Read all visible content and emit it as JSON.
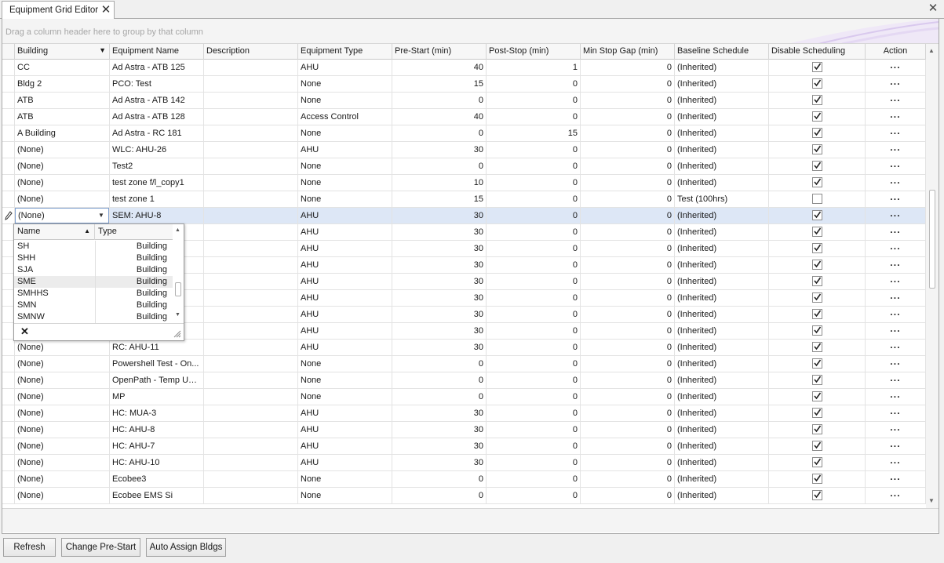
{
  "tab": {
    "title": "Equipment Grid Editor",
    "close_glyph": "✕"
  },
  "window": {
    "close_glyph": "✕"
  },
  "group_panel": {
    "hint": "Drag a column header here to group by that column"
  },
  "columns": [
    {
      "key": "building",
      "label": "Building",
      "sorted": "descending"
    },
    {
      "key": "equipment_name",
      "label": "Equipment Name"
    },
    {
      "key": "description",
      "label": "Description"
    },
    {
      "key": "equipment_type",
      "label": "Equipment Type"
    },
    {
      "key": "pre_start",
      "label": "Pre-Start (min)"
    },
    {
      "key": "post_stop",
      "label": "Post-Stop (min)"
    },
    {
      "key": "min_stop_gap",
      "label": "Min Stop Gap (min)"
    },
    {
      "key": "baseline_schedule",
      "label": "Baseline Schedule"
    },
    {
      "key": "disable_scheduling",
      "label": "Disable Scheduling"
    },
    {
      "key": "action",
      "label": "Action"
    }
  ],
  "rows": [
    {
      "building": "CC",
      "equipment_name": "Ad Astra - ATB 125",
      "description": "",
      "equipment_type": "AHU",
      "pre_start": "40",
      "post_stop": "1",
      "min_stop_gap": "0",
      "baseline_schedule": "(Inherited)",
      "disable_scheduling": true,
      "action": "···"
    },
    {
      "building": "Bldg 2",
      "equipment_name": "PCO: Test",
      "description": "",
      "equipment_type": "None",
      "pre_start": "15",
      "post_stop": "0",
      "min_stop_gap": "0",
      "baseline_schedule": "(Inherited)",
      "disable_scheduling": true,
      "action": "···"
    },
    {
      "building": "ATB",
      "equipment_name": "Ad Astra - ATB 142",
      "description": "",
      "equipment_type": "None",
      "pre_start": "0",
      "post_stop": "0",
      "min_stop_gap": "0",
      "baseline_schedule": "(Inherited)",
      "disable_scheduling": true,
      "action": "···"
    },
    {
      "building": "ATB",
      "equipment_name": "Ad Astra - ATB 128",
      "description": "",
      "equipment_type": "Access Control",
      "pre_start": "40",
      "post_stop": "0",
      "min_stop_gap": "0",
      "baseline_schedule": "(Inherited)",
      "disable_scheduling": true,
      "action": "···"
    },
    {
      "building": "A Building",
      "equipment_name": "Ad Astra - RC 181",
      "description": "",
      "equipment_type": "None",
      "pre_start": "0",
      "post_stop": "15",
      "min_stop_gap": "0",
      "baseline_schedule": "(Inherited)",
      "disable_scheduling": true,
      "action": "···"
    },
    {
      "building": "(None)",
      "equipment_name": "WLC: AHU-26",
      "description": "",
      "equipment_type": "AHU",
      "pre_start": "30",
      "post_stop": "0",
      "min_stop_gap": "0",
      "baseline_schedule": "(Inherited)",
      "disable_scheduling": true,
      "action": "···"
    },
    {
      "building": "(None)",
      "equipment_name": "Test2",
      "description": "",
      "equipment_type": "None",
      "pre_start": "0",
      "post_stop": "0",
      "min_stop_gap": "0",
      "baseline_schedule": "(Inherited)",
      "disable_scheduling": true,
      "action": "···"
    },
    {
      "building": "(None)",
      "equipment_name": "test zone f/l_copy1",
      "description": "",
      "equipment_type": "None",
      "pre_start": "10",
      "post_stop": "0",
      "min_stop_gap": "0",
      "baseline_schedule": "(Inherited)",
      "disable_scheduling": true,
      "action": "···"
    },
    {
      "building": "(None)",
      "equipment_name": "test zone 1",
      "description": "",
      "equipment_type": "None",
      "pre_start": "15",
      "post_stop": "0",
      "min_stop_gap": "0",
      "baseline_schedule": "Test (100hrs)",
      "disable_scheduling": false,
      "action": "···"
    },
    {
      "building": "(None)",
      "equipment_name": "SEM: AHU-8",
      "description": "",
      "equipment_type": "AHU",
      "pre_start": "30",
      "post_stop": "0",
      "min_stop_gap": "0",
      "baseline_schedule": "(Inherited)",
      "disable_scheduling": true,
      "action": "···",
      "focused": true
    },
    {
      "building": "",
      "equipment_name": "",
      "description": "",
      "equipment_type": "AHU",
      "pre_start": "30",
      "post_stop": "0",
      "min_stop_gap": "0",
      "baseline_schedule": "(Inherited)",
      "disable_scheduling": true,
      "action": "···"
    },
    {
      "building": "",
      "equipment_name": "",
      "description": "",
      "equipment_type": "AHU",
      "pre_start": "30",
      "post_stop": "0",
      "min_stop_gap": "0",
      "baseline_schedule": "(Inherited)",
      "disable_scheduling": true,
      "action": "···"
    },
    {
      "building": "",
      "equipment_name": "",
      "description": "",
      "equipment_type": "AHU",
      "pre_start": "30",
      "post_stop": "0",
      "min_stop_gap": "0",
      "baseline_schedule": "(Inherited)",
      "disable_scheduling": true,
      "action": "···"
    },
    {
      "building": "",
      "equipment_name": "",
      "description": "",
      "equipment_type": "AHU",
      "pre_start": "30",
      "post_stop": "0",
      "min_stop_gap": "0",
      "baseline_schedule": "(Inherited)",
      "disable_scheduling": true,
      "action": "···"
    },
    {
      "building": "",
      "equipment_name": "",
      "description": "",
      "equipment_type": "AHU",
      "pre_start": "30",
      "post_stop": "0",
      "min_stop_gap": "0",
      "baseline_schedule": "(Inherited)",
      "disable_scheduling": true,
      "action": "···"
    },
    {
      "building": "",
      "equipment_name": "",
      "description": "",
      "equipment_type": "AHU",
      "pre_start": "30",
      "post_stop": "0",
      "min_stop_gap": "0",
      "baseline_schedule": "(Inherited)",
      "disable_scheduling": true,
      "action": "···"
    },
    {
      "building": "",
      "equipment_name": "",
      "description": "",
      "equipment_type": "AHU",
      "pre_start": "30",
      "post_stop": "0",
      "min_stop_gap": "0",
      "baseline_schedule": "(Inherited)",
      "disable_scheduling": true,
      "action": "···"
    },
    {
      "building": "(None)",
      "equipment_name": "RC: AHU-11",
      "description": "",
      "equipment_type": "AHU",
      "pre_start": "30",
      "post_stop": "0",
      "min_stop_gap": "0",
      "baseline_schedule": "(Inherited)",
      "disable_scheduling": true,
      "action": "···"
    },
    {
      "building": "(None)",
      "equipment_name": "Powershell Test - On...",
      "description": "",
      "equipment_type": "None",
      "pre_start": "0",
      "post_stop": "0",
      "min_stop_gap": "0",
      "baseline_schedule": "(Inherited)",
      "disable_scheduling": true,
      "action": "···"
    },
    {
      "building": "(None)",
      "equipment_name": "OpenPath - Temp Unl...",
      "description": "",
      "equipment_type": "None",
      "pre_start": "0",
      "post_stop": "0",
      "min_stop_gap": "0",
      "baseline_schedule": "(Inherited)",
      "disable_scheduling": true,
      "action": "···"
    },
    {
      "building": "(None)",
      "equipment_name": "MP",
      "description": "",
      "equipment_type": "None",
      "pre_start": "0",
      "post_stop": "0",
      "min_stop_gap": "0",
      "baseline_schedule": "(Inherited)",
      "disable_scheduling": true,
      "action": "···"
    },
    {
      "building": "(None)",
      "equipment_name": "HC: MUA-3",
      "description": "",
      "equipment_type": "AHU",
      "pre_start": "30",
      "post_stop": "0",
      "min_stop_gap": "0",
      "baseline_schedule": "(Inherited)",
      "disable_scheduling": true,
      "action": "···"
    },
    {
      "building": "(None)",
      "equipment_name": "HC: AHU-8",
      "description": "",
      "equipment_type": "AHU",
      "pre_start": "30",
      "post_stop": "0",
      "min_stop_gap": "0",
      "baseline_schedule": "(Inherited)",
      "disable_scheduling": true,
      "action": "···"
    },
    {
      "building": "(None)",
      "equipment_name": "HC: AHU-7",
      "description": "",
      "equipment_type": "AHU",
      "pre_start": "30",
      "post_stop": "0",
      "min_stop_gap": "0",
      "baseline_schedule": "(Inherited)",
      "disable_scheduling": true,
      "action": "···"
    },
    {
      "building": "(None)",
      "equipment_name": "HC: AHU-10",
      "description": "",
      "equipment_type": "AHU",
      "pre_start": "30",
      "post_stop": "0",
      "min_stop_gap": "0",
      "baseline_schedule": "(Inherited)",
      "disable_scheduling": true,
      "action": "···"
    },
    {
      "building": "(None)",
      "equipment_name": "Ecobee3",
      "description": "",
      "equipment_type": "None",
      "pre_start": "0",
      "post_stop": "0",
      "min_stop_gap": "0",
      "baseline_schedule": "(Inherited)",
      "disable_scheduling": true,
      "action": "···"
    },
    {
      "building": "(None)",
      "equipment_name": "Ecobee EMS Si",
      "description": "",
      "equipment_type": "None",
      "pre_start": "0",
      "post_stop": "0",
      "min_stop_gap": "0",
      "baseline_schedule": "(Inherited)",
      "disable_scheduling": true,
      "action": "···"
    }
  ],
  "editor": {
    "value": "(None)",
    "dropdown_glyph": "▼",
    "row_indicator_icon": "pencil-icon"
  },
  "dropdown": {
    "columns": [
      {
        "label": "Name",
        "sort_glyph": "▲"
      },
      {
        "label": "Type"
      }
    ],
    "items": [
      {
        "name": "SH",
        "type": "Building"
      },
      {
        "name": "SHH",
        "type": "Building"
      },
      {
        "name": "SJA",
        "type": "Building"
      },
      {
        "name": "SME",
        "type": "Building",
        "hot": true
      },
      {
        "name": "SMHHS",
        "type": "Building"
      },
      {
        "name": "SMN",
        "type": "Building"
      },
      {
        "name": "SMNW",
        "type": "Building"
      }
    ],
    "clear_glyph": "✕"
  },
  "buttons": {
    "refresh": "Refresh",
    "change_prestart": "Change Pre-Start",
    "auto_assign": "Auto Assign Bldgs"
  },
  "colors": {
    "focused_row": "#dde7f6",
    "editor_border": "#7e9fcf",
    "hint_text": "#a6a6a6"
  }
}
